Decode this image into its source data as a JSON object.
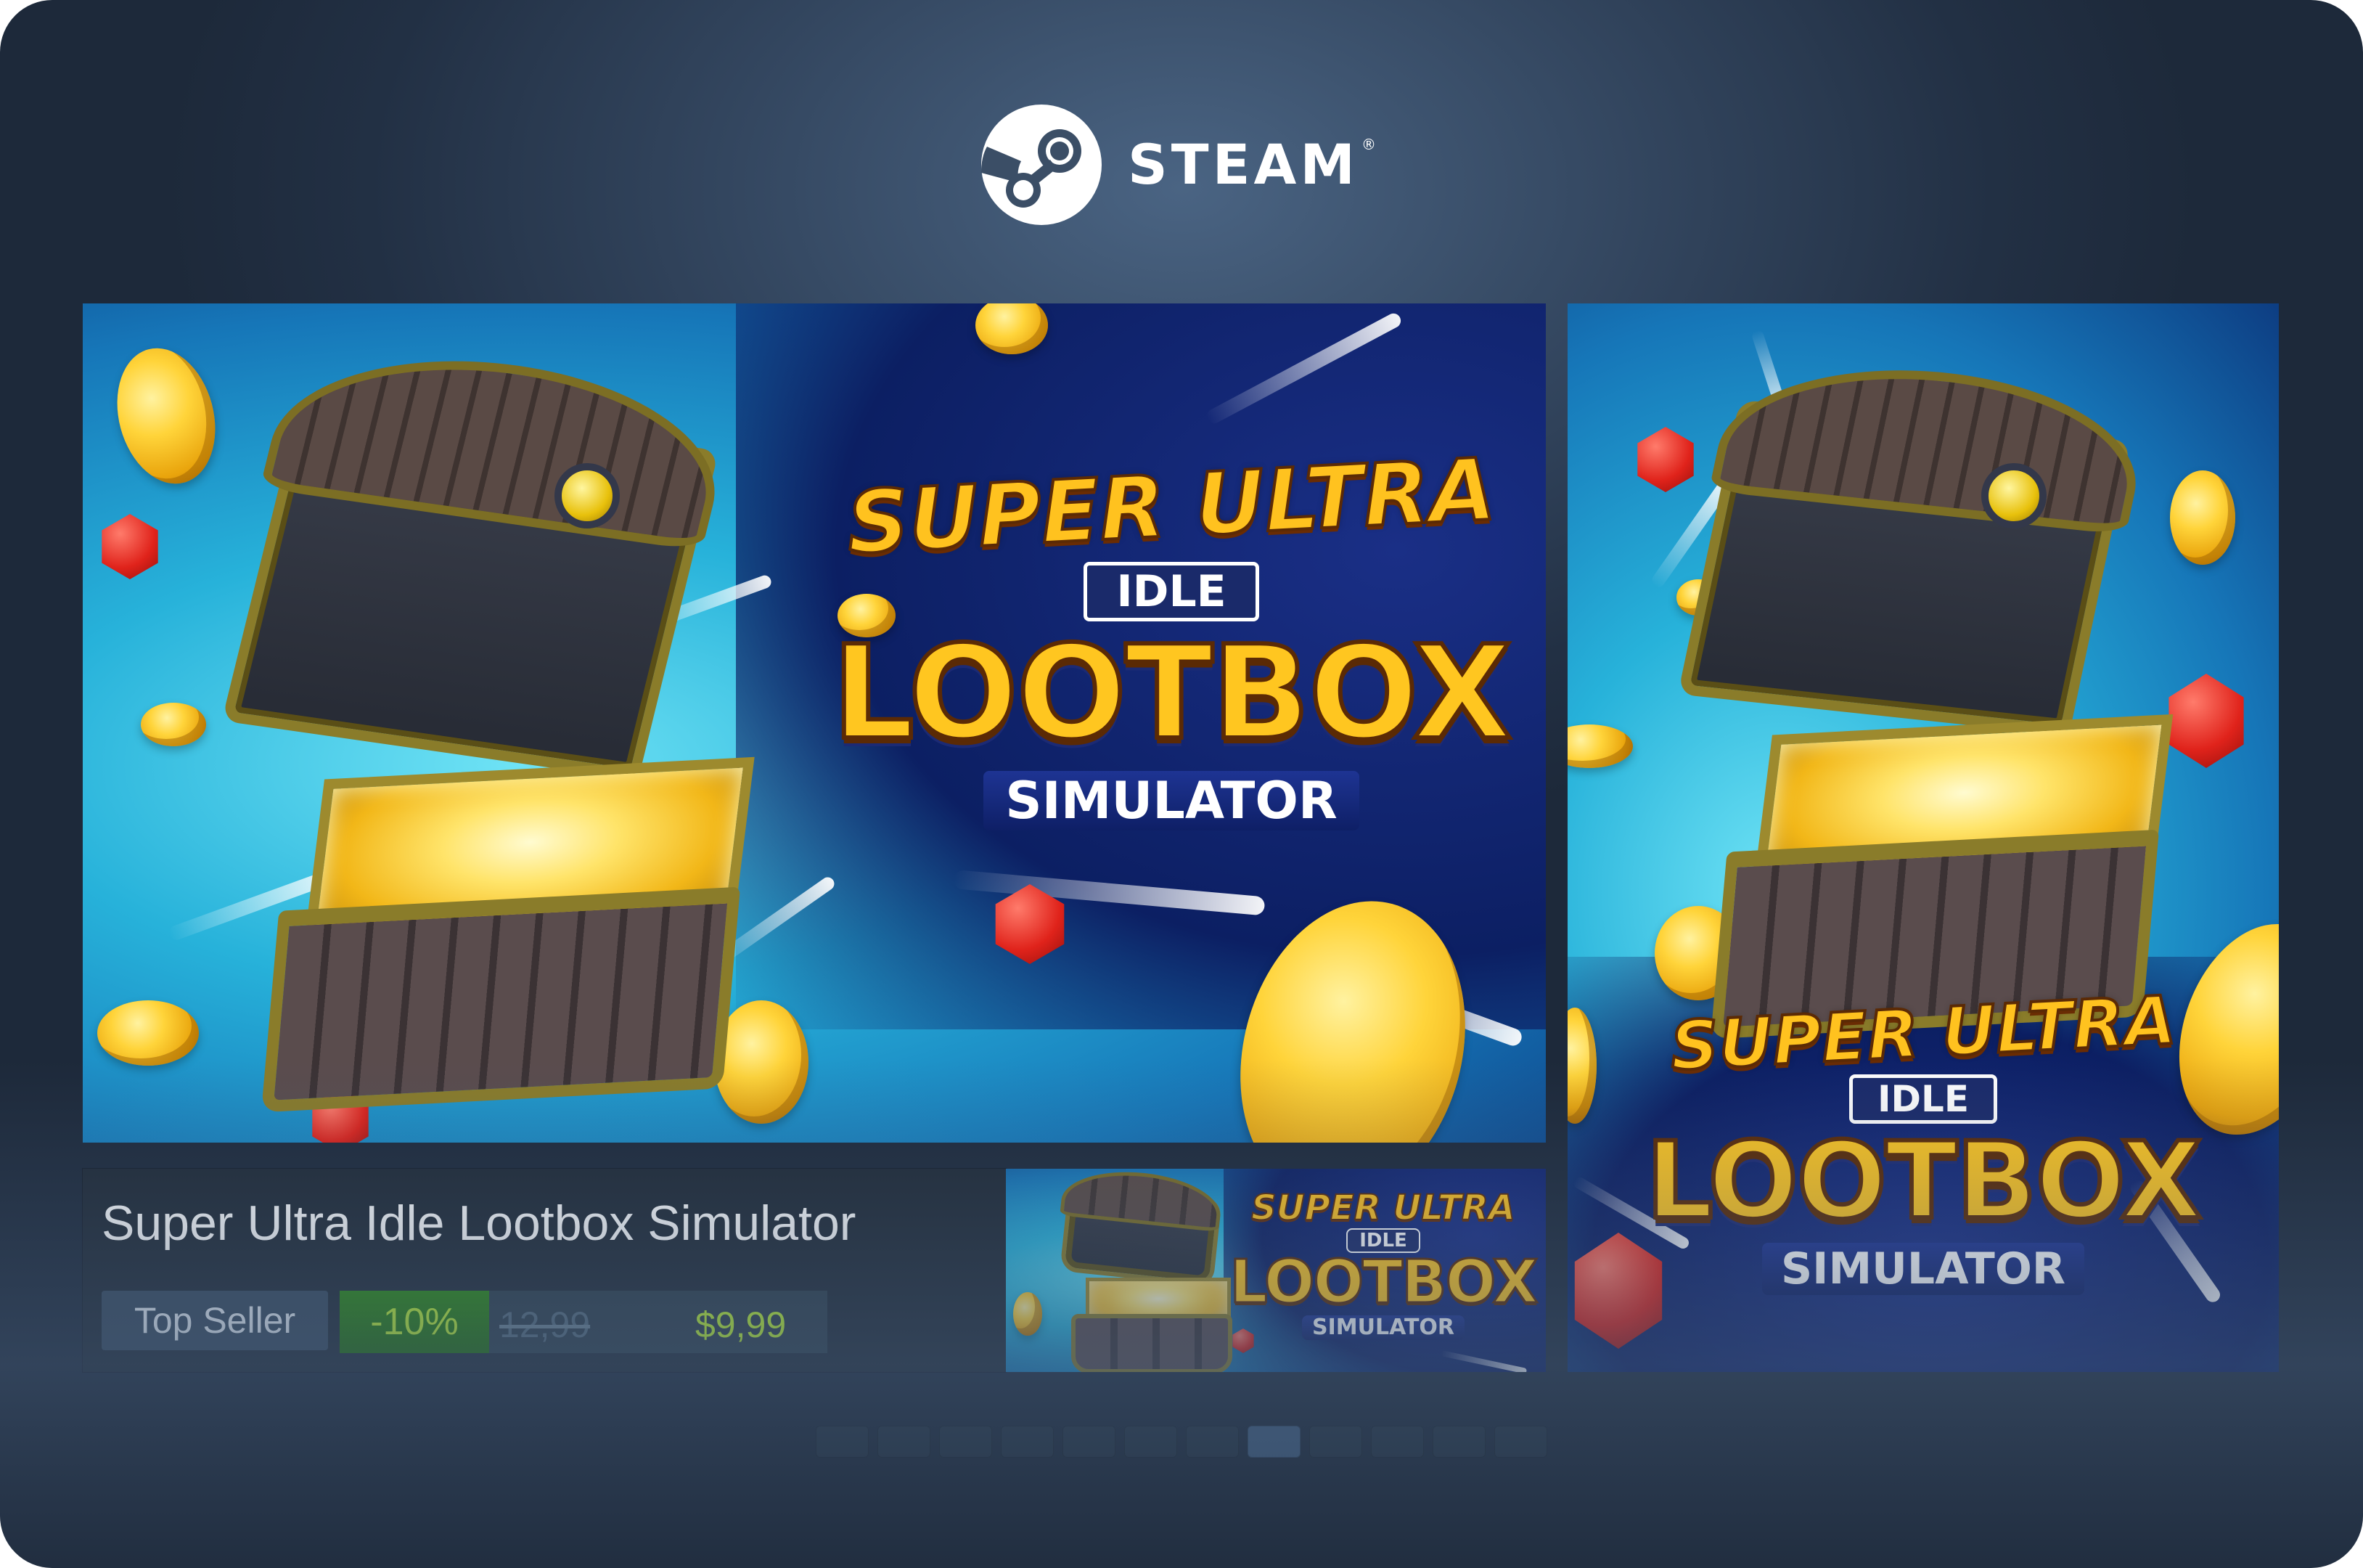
{
  "brand": {
    "name": "STEAM",
    "registered_mark": "®"
  },
  "capsule": {
    "game_title": "Super Ultra Idle Lootbox Simulator",
    "logo_lines": [
      "SUPER ULTRA",
      "IDLE",
      "LOOTBOX",
      "SIMULATOR"
    ],
    "tag": "Top Seller",
    "discount_label": "-10%",
    "original_price": "12,99",
    "final_price": "$9,99"
  },
  "carousel": {
    "total_pages": 12,
    "active_index": 7
  },
  "colors": {
    "accent_green": "#bef52e",
    "discount_bg": "#1f6e08",
    "panel_bg": "#1f2935"
  }
}
